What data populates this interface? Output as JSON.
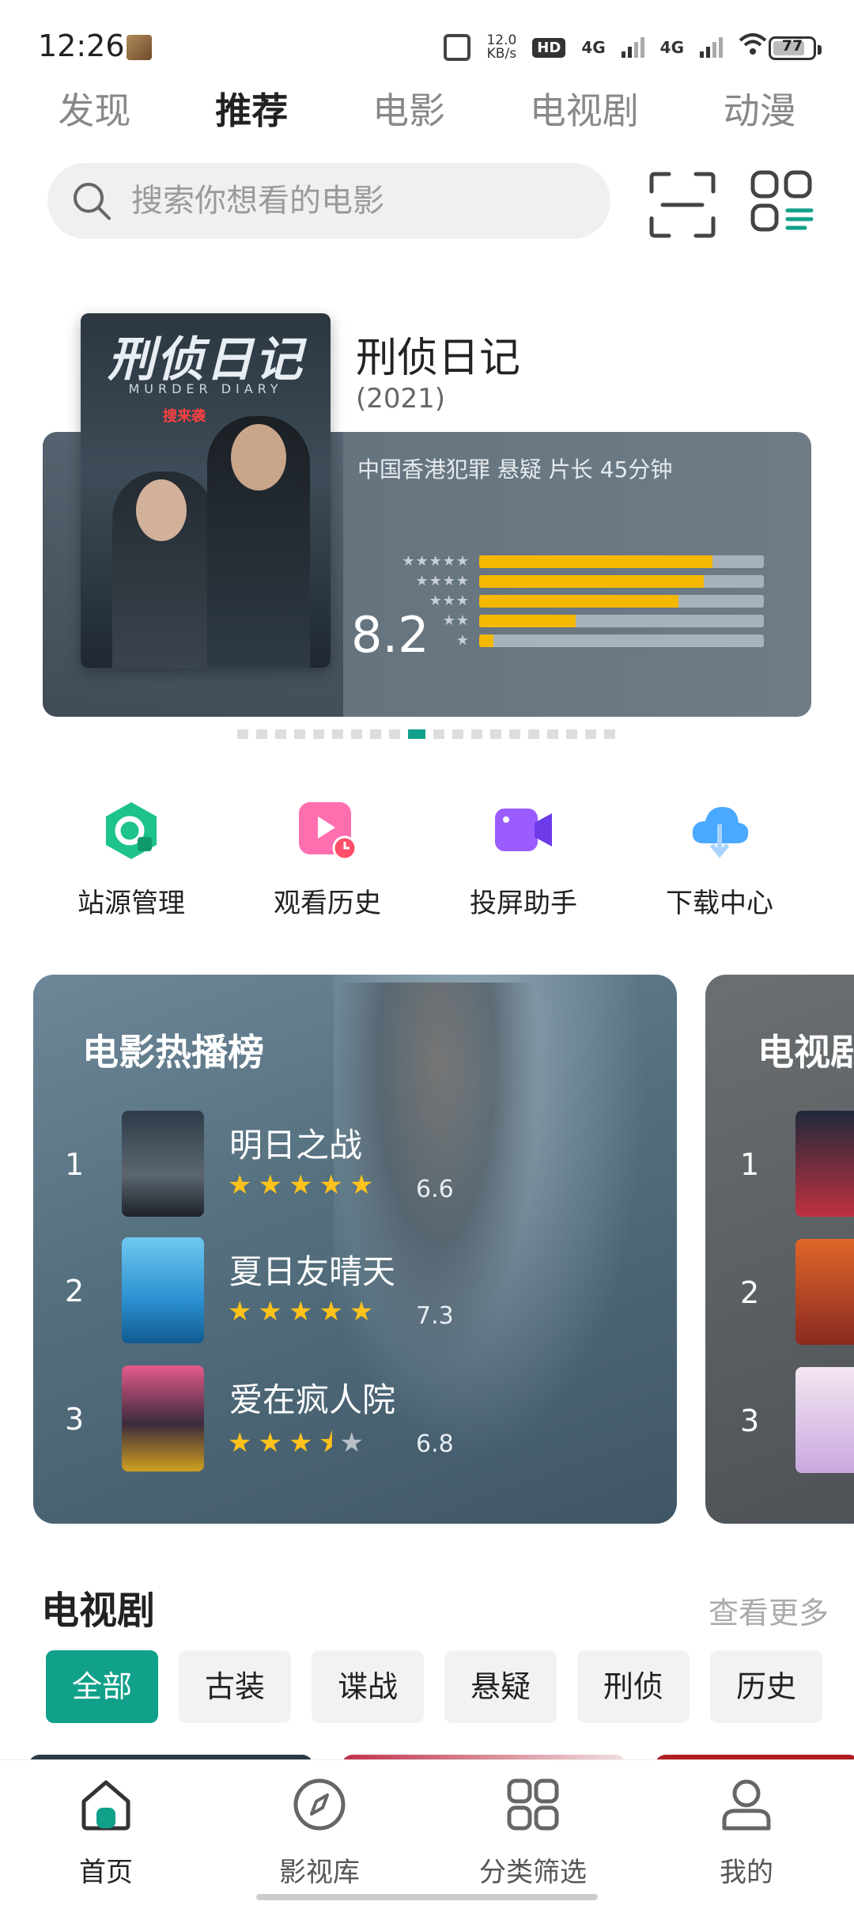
{
  "status_bar": {
    "time": "12:26",
    "net_speed_value": "12.0",
    "net_speed_unit": "KB/s",
    "hd_badge": "HD",
    "network_1": "4G",
    "network_2": "4G",
    "battery": "77"
  },
  "top_tabs": [
    {
      "label": "发现",
      "active": false
    },
    {
      "label": "推荐",
      "active": true
    },
    {
      "label": "电影",
      "active": false
    },
    {
      "label": "电视剧",
      "active": false
    },
    {
      "label": "动漫",
      "active": false
    }
  ],
  "search": {
    "placeholder": "搜索你想看的电影"
  },
  "hero": {
    "poster_title": "刑侦日记",
    "poster_subtitle": "MURDER DIARY",
    "poster_stamp": "搜来袭",
    "title": "刑侦日记",
    "year": "(2021)",
    "meta": "中国香港犯罪 悬疑 片长 45分钟",
    "score": "8.2",
    "rating_distribution": [
      0.82,
      0.79,
      0.7,
      0.34,
      0.05
    ],
    "star_rows": [
      "★★★★★",
      "★★★★",
      "★★★",
      "★★",
      "★"
    ],
    "page_count": 20,
    "active_page": 9
  },
  "quick_actions": [
    {
      "label": "站源管理",
      "icon": "source-manage-icon",
      "color": "#1ec38a"
    },
    {
      "label": "观看历史",
      "icon": "watch-history-icon",
      "color": "#ff5fa2"
    },
    {
      "label": "投屏助手",
      "icon": "cast-assistant-icon",
      "color": "#8a4dff"
    },
    {
      "label": "下载中心",
      "icon": "download-center-icon",
      "color": "#3aa1ff"
    }
  ],
  "movie_rank": {
    "title": "电影热播榜",
    "items": [
      {
        "rank": "1",
        "name": "明日之战",
        "score": "6.6",
        "stars": "★★★★★",
        "stars_off": ""
      },
      {
        "rank": "2",
        "name": "夏日友晴天",
        "score": "7.3",
        "stars": "★★★★★",
        "stars_off": ""
      },
      {
        "rank": "3",
        "name": "爱在疯人院",
        "score": "6.8",
        "stars": "★★★⯨",
        "stars_off": "★"
      }
    ]
  },
  "tv_rank": {
    "title": "电视剧",
    "ranks": [
      "1",
      "2",
      "3"
    ]
  },
  "tv_section": {
    "title": "电视剧",
    "more": "查看更多",
    "chips": [
      {
        "label": "全部",
        "active": true
      },
      {
        "label": "古装",
        "active": false
      },
      {
        "label": "谍战",
        "active": false
      },
      {
        "label": "悬疑",
        "active": false
      },
      {
        "label": "刑侦",
        "active": false
      },
      {
        "label": "历史",
        "active": false
      }
    ]
  },
  "bottom_nav": [
    {
      "label": "首页",
      "icon": "home-icon",
      "active": true
    },
    {
      "label": "影视库",
      "icon": "compass-icon",
      "active": false
    },
    {
      "label": "分类筛选",
      "icon": "category-grid-icon",
      "active": false
    },
    {
      "label": "我的",
      "icon": "profile-icon",
      "active": false
    }
  ],
  "colors": {
    "accent": "#11a08a",
    "star": "#ffc21a",
    "bar_fill": "#f5b800"
  }
}
